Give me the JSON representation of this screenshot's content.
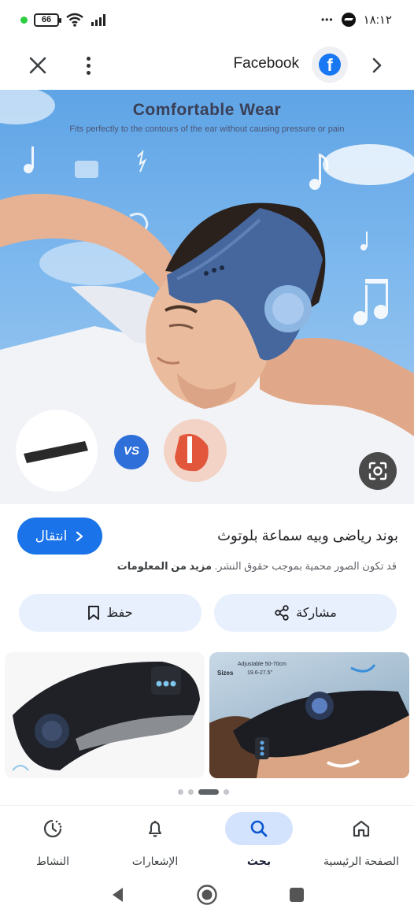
{
  "status_bar": {
    "battery": "66",
    "time": "١٨:١٢",
    "more": "•••"
  },
  "top_bar": {
    "source": "Facebook",
    "source_initial": "f"
  },
  "hero_image": {
    "title": "Comfortable Wear",
    "subtitle": "Fits perfectly to the contours of the ear without causing pressure or pain",
    "badge": "VS"
  },
  "result": {
    "title": "بوند رياضى وبيه سماعة بلوتوث",
    "visit_label": "انتقال",
    "copyright_notice": "قد تكون الصور محمية بموجب حقوق النشر.",
    "more_info": "مزيد من المعلومات"
  },
  "actions": {
    "share_label": "مشاركة",
    "save_label": "حفظ"
  },
  "related": {
    "right_size_label": "Adjustable 50-70cm",
    "right_sizes": "Sizes",
    "right_size_range": "19.6-27.5\""
  },
  "bottom_nav": {
    "items": [
      {
        "label": "الصفحة الرئيسية",
        "icon": "home-icon"
      },
      {
        "label": "بحث",
        "icon": "search-icon",
        "active": true
      },
      {
        "label": "الإشعارات",
        "icon": "bell-icon"
      },
      {
        "label": "النشاط",
        "icon": "activity-icon"
      }
    ]
  },
  "colors": {
    "accent": "#1a73e8",
    "pill": "#e8f0fe",
    "nav_active": "#d3e3fd",
    "facebook": "#1877f2"
  }
}
